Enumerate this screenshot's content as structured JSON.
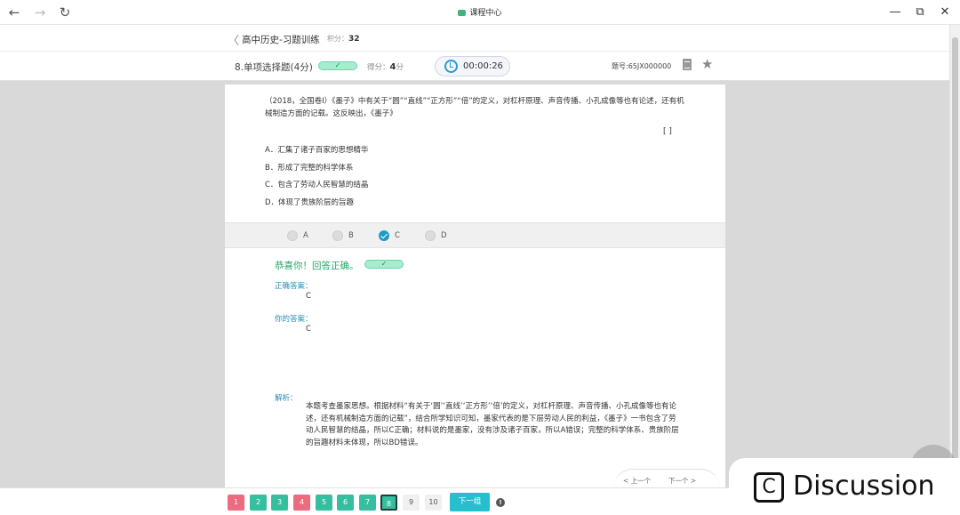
{
  "window": {
    "title": "课程中心",
    "back_icon": "←",
    "forward_icon": "→",
    "refresh_icon": "↻",
    "minimize_icon": "—",
    "restore_icon": "⧉",
    "close_icon": "✕"
  },
  "header": {
    "back_icon": "〈",
    "course": "高中历史-习题训练",
    "score_label": "积分：",
    "score_value": "32"
  },
  "question_bar": {
    "type_label": "8.单项选择题(4分)",
    "status_check": "✓",
    "got_label": "得分：",
    "got_value": "4",
    "got_unit": "分",
    "timer": "00:00:26",
    "question_id": "题号:65JX000000",
    "star_icon": "★"
  },
  "question": {
    "stem": "（2018，全国卷Ⅰ）《墨子》中有关于“圆”“直线”“正方形”“倍”的定义，对杠杆原理、声音传播、小孔成像等也有论述，还有机械制造方面的记载。这反映出，《墨子》",
    "bracket": "[      ]",
    "options": [
      "A．汇集了诸子百家的思想精华",
      "B．形成了完整的科学体系",
      "C．包含了劳动人民智慧的结晶",
      "D．体现了贵族阶层的旨趣"
    ]
  },
  "choices": [
    {
      "label": "A",
      "selected": false
    },
    {
      "label": "B",
      "selected": false
    },
    {
      "label": "C",
      "selected": true
    },
    {
      "label": "D",
      "selected": false
    }
  ],
  "result": {
    "message": "恭喜你！回答正确。",
    "check": "✓",
    "correct_label": "正确答案：",
    "correct_value": "C",
    "yours_label": "你的答案：",
    "yours_value": "C",
    "analysis_label": "解析：",
    "analysis_text": "本题考查墨家思想。根据材料“有关于‘圆’‘直线’‘正方形’‘倍’的定义，对杠杆原理、声音传播、小孔成像等也有论述，还有机械制造方面的记载”，结合所学知识可知，墨家代表的是下层劳动人民的利益，《墨子》一书包含了劳动人民智慧的结晶，所以C正确；材料说的是墨家，没有涉及诸子百家，所以A错误；完整的科学体系、贵族阶层的旨趣材料未体现，所以BD错误。"
  },
  "pager": {
    "prev": "< 上一个",
    "next": "下一个 >"
  },
  "bottom": {
    "questions": [
      {
        "label": "1",
        "state": "red"
      },
      {
        "label": "2",
        "state": "green"
      },
      {
        "label": "3",
        "state": "green"
      },
      {
        "label": "4",
        "state": "red"
      },
      {
        "label": "5",
        "state": "green"
      },
      {
        "label": "6",
        "state": "green"
      },
      {
        "label": "7",
        "state": "green"
      },
      {
        "label": "8",
        "state": "current"
      },
      {
        "label": "9",
        "state": "grey"
      },
      {
        "label": "10",
        "state": "grey"
      }
    ],
    "next_group": "下一组",
    "info": "!"
  },
  "overlay": {
    "icon_letter": "C",
    "label": "Discussion"
  }
}
